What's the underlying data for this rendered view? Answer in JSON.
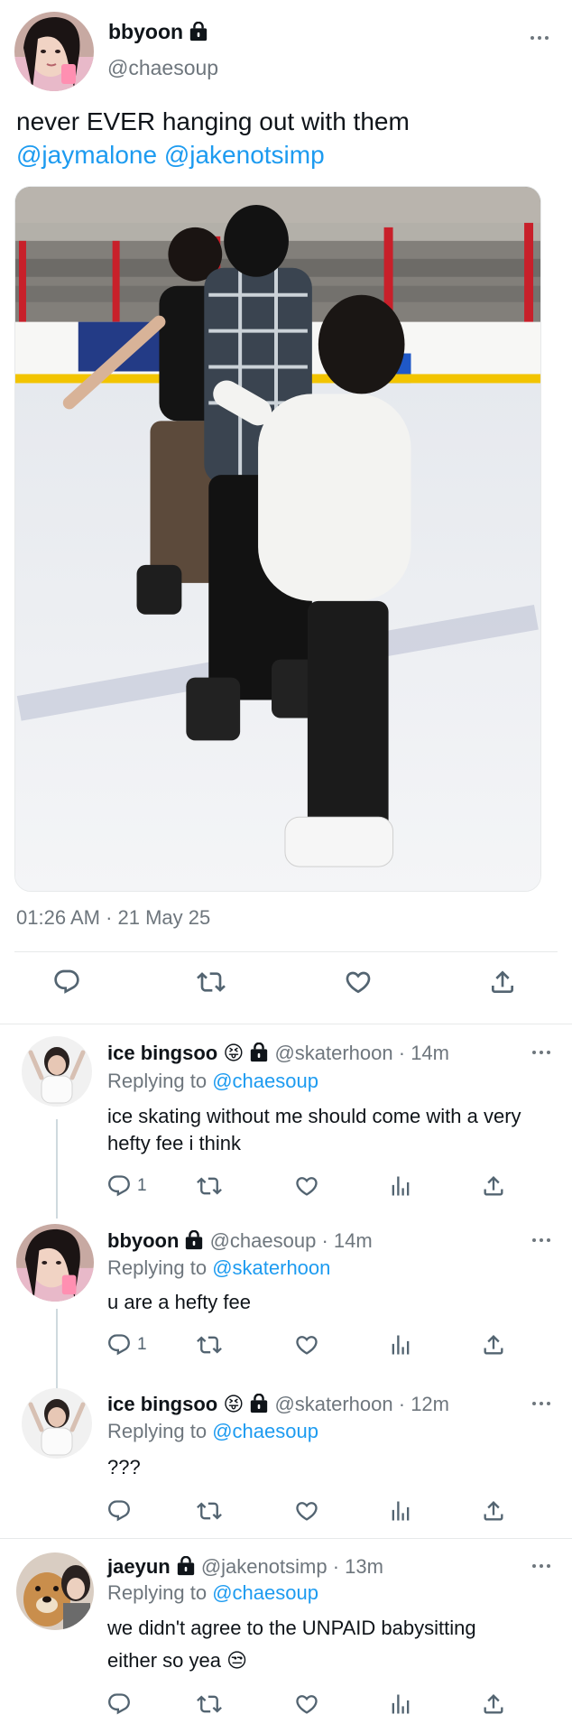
{
  "main_tweet": {
    "display_name": "bbyoon",
    "handle": "@chaesoup",
    "text": "never EVER hanging out with them",
    "mentions": [
      "@jaymalone",
      "@jakenotsimp"
    ],
    "timestamp": "01:26 AM · 21 May 25",
    "actions": [
      "reply-icon",
      "retweet-icon",
      "like-icon",
      "share-icon"
    ]
  },
  "replies": [
    {
      "display_name": "ice bingsoo",
      "emoji": "😝",
      "handle": "@skaterhoon",
      "time": "· 14m",
      "replying_label": "Replying to",
      "replying_to": "@chaesoup",
      "text": "ice skating without me should come with a very hefty fee i think",
      "reply_count": "1"
    },
    {
      "display_name": "bbyoon",
      "handle": "@chaesoup",
      "time": "· 14m",
      "replying_label": "Replying to",
      "replying_to": "@skaterhoon",
      "text": "u are a hefty fee",
      "reply_count": "1"
    },
    {
      "display_name": "ice bingsoo",
      "emoji": "😝",
      "handle": "@skaterhoon",
      "time": "· 12m",
      "replying_label": "Replying to",
      "replying_to": "@chaesoup",
      "text": "???",
      "reply_count": ""
    },
    {
      "display_name": "jaeyun",
      "handle": "@jakenotsimp",
      "time": "· 13m",
      "replying_label": "Replying to",
      "replying_to": "@chaesoup",
      "text_line1": "we didn't agree to the UNPAID babysitting",
      "text_line2": "either so yea",
      "emoji": "😒",
      "reply_count": ""
    }
  ],
  "colors": {
    "link": "#1d9bf0",
    "muted": "#6e767d",
    "icon": "#536471",
    "divider": "#e7e9ea"
  }
}
